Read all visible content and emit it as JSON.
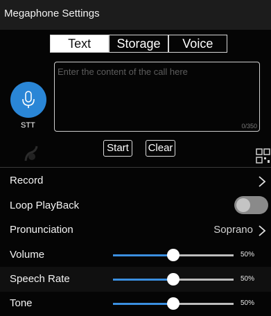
{
  "app": {
    "title": "Megaphone Settings"
  },
  "tabs": [
    {
      "label": "Text",
      "active": true
    },
    {
      "label": "Storage",
      "active": false
    },
    {
      "label": "Voice",
      "active": false
    }
  ],
  "stt": {
    "label": "STT",
    "icon": "microphone-icon"
  },
  "message": {
    "placeholder": "Enter the content of the call here",
    "value": "",
    "counter": "0/350"
  },
  "actions": {
    "start_label": "Start",
    "clear_label": "Clear"
  },
  "settings": {
    "record": {
      "label": "Record"
    },
    "loop_playback": {
      "label": "Loop PlayBack",
      "enabled": false
    },
    "pronunciation": {
      "label": "Pronunciation",
      "value": "Soprano"
    },
    "volume": {
      "label": "Volume",
      "value_text": "50%",
      "fraction": 0.5
    },
    "speech_rate": {
      "label": "Speech Rate",
      "value_text": "50%",
      "fraction": 0.5
    },
    "tone": {
      "label": "Tone",
      "value_text": "50%",
      "fraction": 0.5
    }
  },
  "colors": {
    "accent": "#3b8fe0",
    "mic_button": "#2a86d6",
    "background": "#050505",
    "titlebar": "#1c1c1c"
  }
}
